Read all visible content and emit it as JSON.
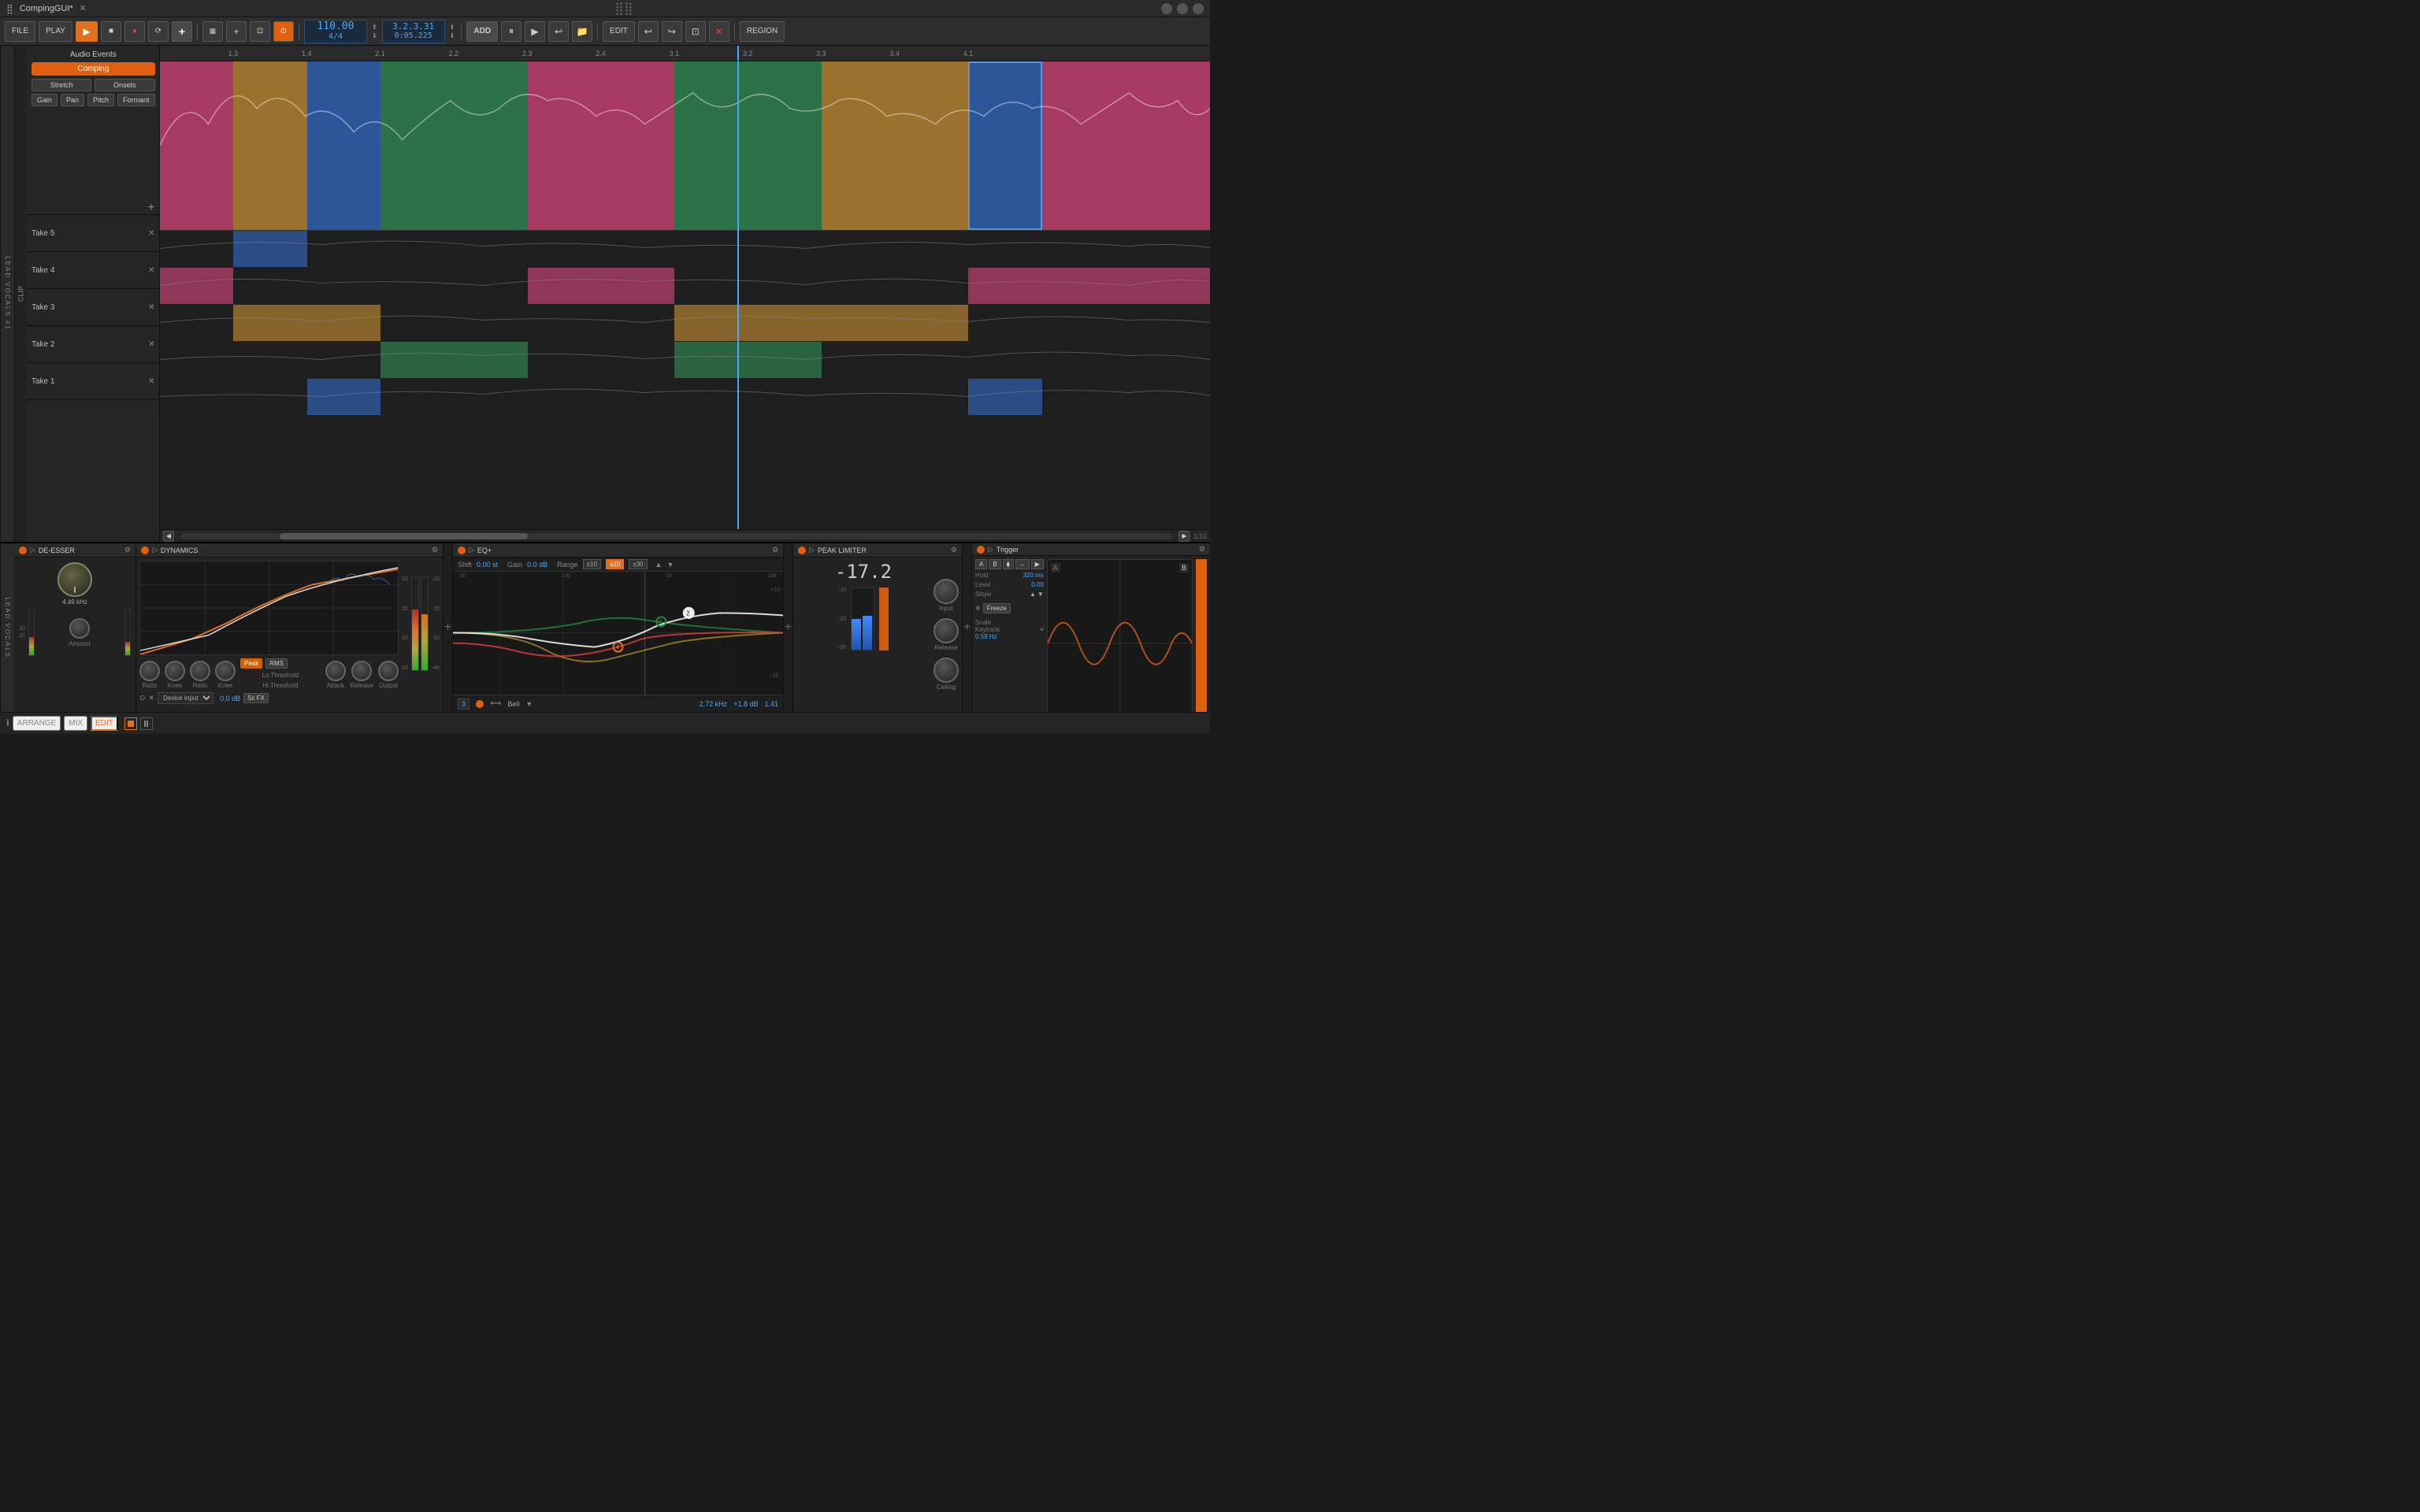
{
  "app": {
    "title": "CompingGUI*",
    "modified": true
  },
  "toolbar": {
    "file_label": "FILE",
    "play_label": "PLAY",
    "tempo": "110.00",
    "time_sig": "4/4",
    "position": "3.2.3.31",
    "time": "0:05.225",
    "edit_label": "EDIT",
    "region_label": "REGION",
    "add_label": "ADD"
  },
  "clip_panel": {
    "audio_events_label": "Audio Events",
    "comping_label": "Comping",
    "stretch_label": "Stretch",
    "onsets_label": "Onsets",
    "gain_label": "Gain",
    "pan_label": "Pan",
    "pitch_label": "Pitch",
    "formant_label": "Formant"
  },
  "takes": [
    {
      "name": "Take 5",
      "id": "take5"
    },
    {
      "name": "Take 4",
      "id": "take4"
    },
    {
      "name": "Take 3",
      "id": "take3"
    },
    {
      "name": "Take 2",
      "id": "take2"
    },
    {
      "name": "Take 1",
      "id": "take1"
    }
  ],
  "ruler_marks": [
    "1.3",
    "1.4",
    "2.1",
    "2.2",
    "2.3",
    "2.4",
    "3.1",
    "3.2",
    "3.3",
    "3.4",
    "4.1"
  ],
  "de_esser": {
    "title": "DE-ESSER",
    "freq_value": "4.49 kHz",
    "amount_label": "Amount",
    "amount_value": "0",
    "db_marks": [
      "10",
      "20"
    ]
  },
  "dynamics": {
    "title": "DYNAMICS",
    "lo_threshold_label": "Lo Threshold",
    "hi_threshold_label": "Hi Threshold",
    "ratio1_label": "Ratio",
    "knee1_label": "Knee",
    "ratio2_label": "Ratio",
    "knee2_label": "Knee",
    "attack_label": "Attack",
    "release_label": "Release",
    "output_label": "Output",
    "peak_label": "Peak",
    "rms_label": "RMS",
    "device_input_label": "Device Input",
    "sc_fx_label": "Sc FX",
    "db_value": "0.0 dB",
    "db_marks_right": [
      "-10",
      "-20",
      "-30",
      "-40"
    ],
    "db_marks_left": [
      "10",
      "20",
      "30",
      "40"
    ]
  },
  "eq": {
    "title": "EQ+",
    "shift_label": "Shift",
    "shift_value": "0.00 st",
    "gain_label": "Gain",
    "gain_value": "0.0 dB",
    "range_label": "Range",
    "range_options": [
      "+10",
      "+20",
      "+30"
    ],
    "freq_value": "2.72 kHz",
    "gain_band_value": "+1.8 dB",
    "q_value": "1.41",
    "band_label": "Bell",
    "band_number": "3"
  },
  "peak_limiter": {
    "title": "PEAK LIMITER",
    "level_label": "-17.2",
    "input_label": "Input",
    "release_label": "Release",
    "ceiling_label": "Ceiling",
    "db_marks": [
      "-10",
      "-20",
      "-30"
    ]
  },
  "oscilloscope": {
    "title": "Trigger",
    "freeze_label": "Freeze",
    "scale_label": "Scale",
    "keytrack_label": "Keytrack",
    "scale_value": "0.59 Hz",
    "hold_label": "Hold",
    "hold_value": "320 ms",
    "level_label": "Level",
    "level_value": "0.00",
    "slope_label": "Slope",
    "bands": [
      "A",
      "B"
    ],
    "band_b_label": "B"
  },
  "bottom_tabs": {
    "arrange_label": "ARRANGE",
    "mix_label": "MIX",
    "edit_label": "EDIT"
  },
  "track_label": "LEAD VOCALS #1",
  "plugin_track_label": "LEAD VOCALS",
  "page_fraction": "1/16"
}
